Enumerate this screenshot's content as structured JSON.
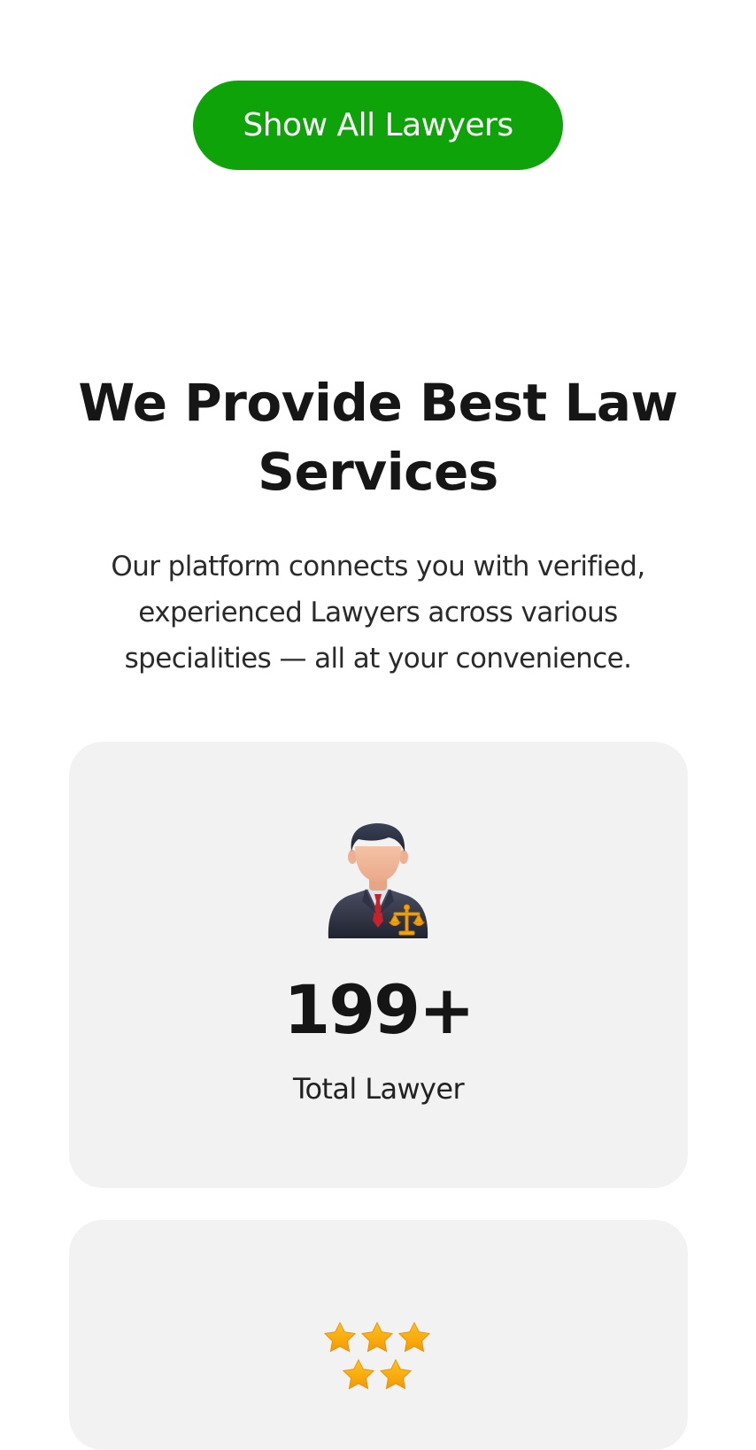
{
  "show_all_button": {
    "label": "Show All Lawyers",
    "color": "#0fa30a"
  },
  "services_section": {
    "title": "We Provide Best Law Services",
    "description": "Our platform connects you with verified, experienced Lawyers across various specialities — all at your convenience."
  },
  "stats": [
    {
      "icon": "lawyer-icon",
      "value": "199+",
      "label": "Total Lawyer"
    },
    {
      "icon": "stars-rating-icon"
    }
  ],
  "colors": {
    "card_background": "#f2f2f2",
    "heading_text": "#161616",
    "star": "#f6b40e"
  }
}
